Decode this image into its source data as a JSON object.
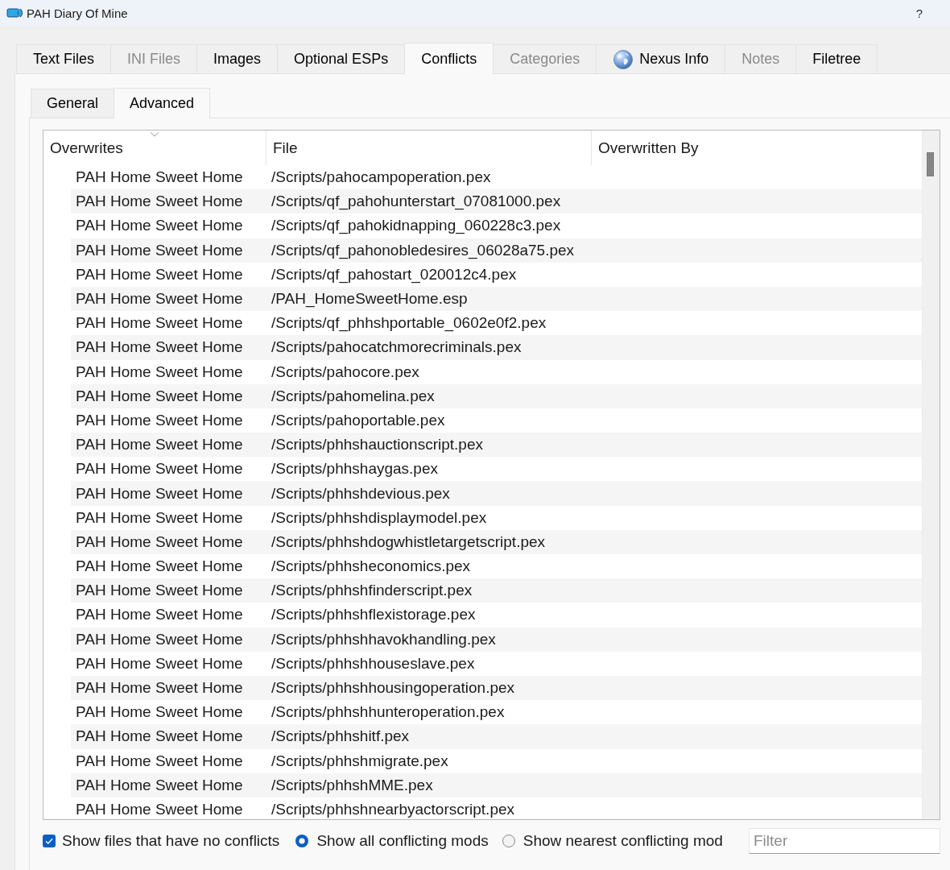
{
  "window": {
    "title": "PAH Diary Of Mine",
    "help": "?"
  },
  "tabs": [
    {
      "label": "Text Files",
      "selected": false,
      "disabled": false,
      "kind": "text"
    },
    {
      "label": "INI Files",
      "selected": false,
      "disabled": true,
      "kind": "text"
    },
    {
      "label": "Images",
      "selected": false,
      "disabled": false,
      "kind": "text"
    },
    {
      "label": "Optional ESPs",
      "selected": false,
      "disabled": false,
      "kind": "text"
    },
    {
      "label": "Conflicts",
      "selected": true,
      "disabled": false,
      "kind": "text"
    },
    {
      "label": "Categories",
      "selected": false,
      "disabled": true,
      "kind": "text"
    },
    {
      "label": "Nexus Info",
      "selected": false,
      "disabled": false,
      "kind": "icon"
    },
    {
      "label": "Notes",
      "selected": false,
      "disabled": true,
      "kind": "text"
    },
    {
      "label": "Filetree",
      "selected": false,
      "disabled": false,
      "kind": "text"
    }
  ],
  "subtabs": [
    {
      "label": "General",
      "selected": false
    },
    {
      "label": "Advanced",
      "selected": true
    }
  ],
  "table": {
    "columns": [
      {
        "label": "Overwrites",
        "sorted": true
      },
      {
        "label": "File",
        "sorted": false
      },
      {
        "label": "Overwritten By",
        "sorted": false
      }
    ],
    "rows": [
      {
        "overwrites": "PAH Home Sweet Home",
        "file": "/Scripts/pahocampoperation.pex"
      },
      {
        "overwrites": "PAH Home Sweet Home",
        "file": "/Scripts/qf_pahohunterstart_07081000.pex"
      },
      {
        "overwrites": "PAH Home Sweet Home",
        "file": "/Scripts/qf_pahokidnapping_060228c3.pex"
      },
      {
        "overwrites": "PAH Home Sweet Home",
        "file": "/Scripts/qf_pahonobledesires_06028a75.pex"
      },
      {
        "overwrites": "PAH Home Sweet Home",
        "file": "/Scripts/qf_pahostart_020012c4.pex"
      },
      {
        "overwrites": "PAH Home Sweet Home",
        "file": "/PAH_HomeSweetHome.esp"
      },
      {
        "overwrites": "PAH Home Sweet Home",
        "file": "/Scripts/qf_phhshportable_0602e0f2.pex"
      },
      {
        "overwrites": "PAH Home Sweet Home",
        "file": "/Scripts/pahocatchmorecriminals.pex"
      },
      {
        "overwrites": "PAH Home Sweet Home",
        "file": "/Scripts/pahocore.pex"
      },
      {
        "overwrites": "PAH Home Sweet Home",
        "file": "/Scripts/pahomelina.pex"
      },
      {
        "overwrites": "PAH Home Sweet Home",
        "file": "/Scripts/pahoportable.pex"
      },
      {
        "overwrites": "PAH Home Sweet Home",
        "file": "/Scripts/phhshauctionscript.pex"
      },
      {
        "overwrites": "PAH Home Sweet Home",
        "file": "/Scripts/phhshaygas.pex"
      },
      {
        "overwrites": "PAH Home Sweet Home",
        "file": "/Scripts/phhshdevious.pex"
      },
      {
        "overwrites": "PAH Home Sweet Home",
        "file": "/Scripts/phhshdisplaymodel.pex"
      },
      {
        "overwrites": "PAH Home Sweet Home",
        "file": "/Scripts/phhshdogwhistletargetscript.pex"
      },
      {
        "overwrites": "PAH Home Sweet Home",
        "file": "/Scripts/phhsheconomics.pex"
      },
      {
        "overwrites": "PAH Home Sweet Home",
        "file": "/Scripts/phhshfinderscript.pex"
      },
      {
        "overwrites": "PAH Home Sweet Home",
        "file": "/Scripts/phhshflexistorage.pex"
      },
      {
        "overwrites": "PAH Home Sweet Home",
        "file": "/Scripts/phhshhavokhandling.pex"
      },
      {
        "overwrites": "PAH Home Sweet Home",
        "file": "/Scripts/phhshhouseslave.pex"
      },
      {
        "overwrites": "PAH Home Sweet Home",
        "file": "/Scripts/phhshhousingoperation.pex"
      },
      {
        "overwrites": "PAH Home Sweet Home",
        "file": "/Scripts/phhshhunteroperation.pex"
      },
      {
        "overwrites": "PAH Home Sweet Home",
        "file": "/Scripts/phhshitf.pex"
      },
      {
        "overwrites": "PAH Home Sweet Home",
        "file": "/Scripts/phhshmigrate.pex"
      },
      {
        "overwrites": "PAH Home Sweet Home",
        "file": "/Scripts/phhshMME.pex"
      },
      {
        "overwrites": "PAH Home Sweet Home",
        "file": "/Scripts/phhshnearbyactorscript.pex"
      }
    ]
  },
  "options": {
    "no_conflicts": {
      "label": "Show files that have no conflicts",
      "checked": true
    },
    "modes": [
      {
        "label": "Show all conflicting mods",
        "selected": true
      },
      {
        "label": "Show nearest conflicting mod",
        "selected": false
      }
    ],
    "filter": {
      "placeholder": "Filter"
    }
  }
}
